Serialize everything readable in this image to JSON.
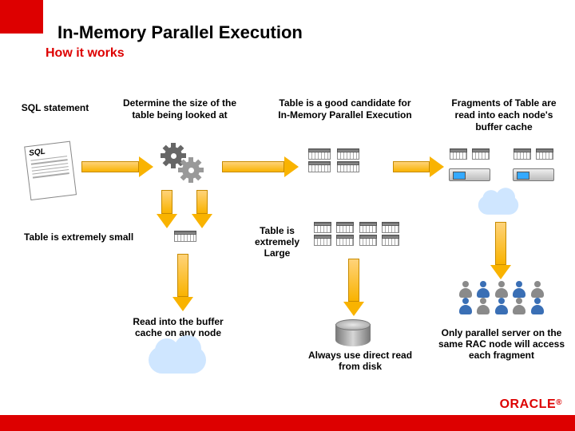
{
  "header": {
    "title": "In-Memory Parallel Execution",
    "subtitle": "How it works"
  },
  "columns": {
    "sql": "SQL statement",
    "determine": "Determine the size of the table being looked at",
    "good_candidate": "Table is a good candidate for In-Memory Parallel Execution",
    "fragments": "Fragments of Table are read into each node's buffer cache"
  },
  "labels": {
    "sql_doc": "SQL",
    "extremely_small": "Table is extremely small",
    "extremely_large": "Table is extremely Large",
    "read_buffer": "Read into the buffer cache on any node",
    "direct_read": "Always use direct read from disk",
    "only_parallel": "Only parallel server on the same RAC node will access each fragment"
  },
  "brand": "ORACLE"
}
